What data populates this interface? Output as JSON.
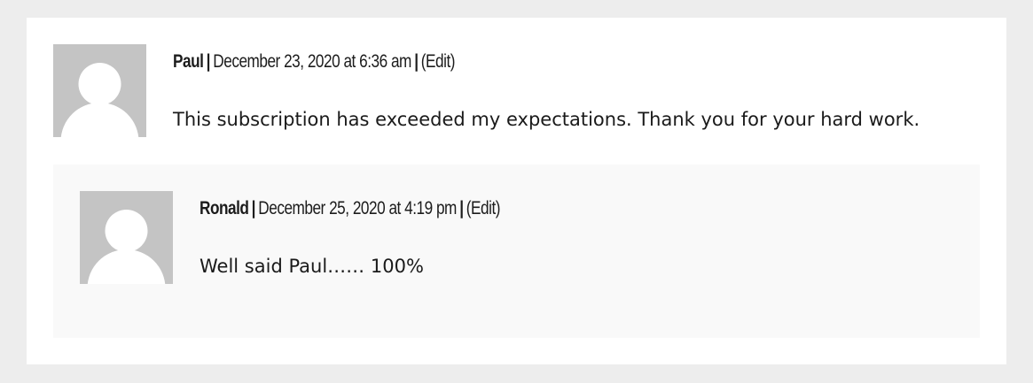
{
  "comments": [
    {
      "author": "Paul",
      "separator_1": "|",
      "date": "December 23, 2020 at 6:36 am",
      "separator_2": "|",
      "edit_label": "(Edit)",
      "text": "This subscription has exceeded my expectations. Thank you for your hard work.",
      "avatar_icon": "default-avatar-icon"
    }
  ],
  "replies": [
    {
      "author": "Ronald",
      "separator_1": "|",
      "date": "December 25, 2020 at 4:19 pm",
      "separator_2": "|",
      "edit_label": "(Edit)",
      "text": "Well said Paul…… 100%",
      "avatar_icon": "default-avatar-icon"
    }
  ],
  "colors": {
    "page_background": "#ededed",
    "card_background": "#ffffff",
    "reply_background": "#f9f9f9",
    "avatar_background": "#c4c4c4",
    "avatar_silhouette": "#ffffff"
  }
}
